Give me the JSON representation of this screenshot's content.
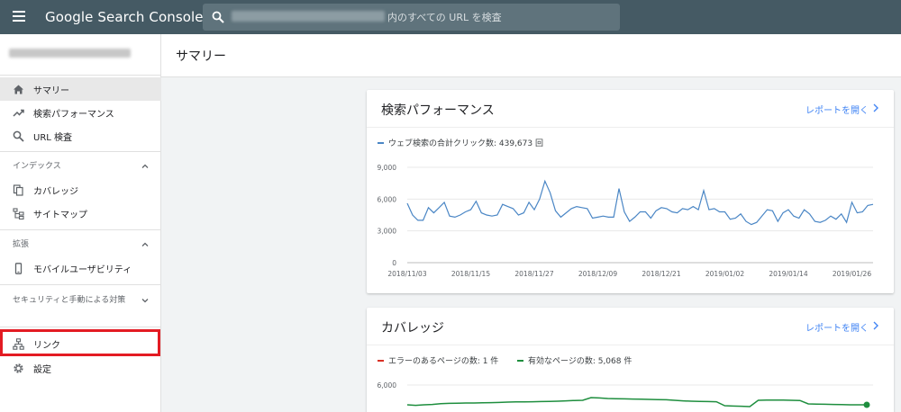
{
  "app": {
    "title": "Google Search Console"
  },
  "search": {
    "placeholder": "内のすべての URL を検査"
  },
  "sidebar": {
    "nav_top": [
      {
        "label": "サマリー",
        "icon": "home-icon",
        "active": true
      },
      {
        "label": "検索パフォーマンス",
        "icon": "trending-up-icon",
        "active": false
      },
      {
        "label": "URL 検査",
        "icon": "search-icon",
        "active": false
      }
    ],
    "sections": [
      {
        "label": "インデックス",
        "expanded": true,
        "items": [
          {
            "label": "カバレッジ",
            "icon": "file-copy-icon"
          },
          {
            "label": "サイトマップ",
            "icon": "sitemap-icon"
          }
        ]
      },
      {
        "label": "拡張",
        "expanded": true,
        "items": [
          {
            "label": "モバイルユーザビリティ",
            "icon": "smartphone-icon"
          }
        ]
      },
      {
        "label": "セキュリティと手動による対策",
        "expanded": false,
        "items": []
      }
    ],
    "nav_bottom": [
      {
        "label": "リンク",
        "icon": "links-icon"
      },
      {
        "label": "設定",
        "icon": "gear-icon"
      }
    ]
  },
  "page": {
    "title": "サマリー"
  },
  "cards": {
    "performance": {
      "title": "検索パフォーマンス",
      "link": "レポートを開く"
    },
    "coverage": {
      "title": "カバレッジ",
      "link": "レポートを開く"
    }
  },
  "colors": {
    "topbar": "#455a64",
    "accent": "#4285f4",
    "line_blue": "#4a86c5",
    "error_red": "#d93025",
    "valid_green": "#1e8e3e",
    "highlight": "#e31b23"
  },
  "chart_data": [
    {
      "type": "line",
      "legend": "ウェブ検索の合計クリック数: 439,673 回",
      "y_ticks": [
        "9,000",
        "6,000",
        "3,000",
        "0"
      ],
      "ylim": [
        0,
        9000
      ],
      "x_tick_labels": [
        "2018/11/03",
        "2018/11/15",
        "2018/11/27",
        "2018/12/09",
        "2018/12/21",
        "2019/01/02",
        "2019/01/14",
        "2019/01/26"
      ],
      "x_start": "2018/11/03",
      "series": [
        {
          "color": "#4a86c5",
          "values": [
            5600,
            4500,
            4000,
            4000,
            5200,
            4700,
            5200,
            5700,
            4400,
            4300,
            4500,
            4800,
            5000,
            5800,
            4700,
            4500,
            4400,
            4500,
            5500,
            5300,
            5100,
            4500,
            4700,
            5700,
            5000,
            6000,
            7700,
            6600,
            4900,
            4300,
            4700,
            5100,
            5300,
            5200,
            5100,
            4200,
            4300,
            4400,
            4300,
            4300,
            7000,
            4800,
            3900,
            4300,
            4800,
            4800,
            4200,
            4900,
            5200,
            5100,
            4800,
            4700,
            5100,
            5000,
            5300,
            5000,
            6800,
            5000,
            5100,
            4800,
            4800,
            4100,
            4200,
            4600,
            3900,
            3600,
            3800,
            4400,
            5000,
            4900,
            3900,
            4700,
            5000,
            4400,
            4200,
            5000,
            4600,
            3900,
            3800,
            4000,
            4400,
            4100,
            4600,
            3800,
            5700,
            4700,
            4800,
            5400,
            5500
          ]
        }
      ]
    },
    {
      "type": "line",
      "legend_series": [
        "エラーのあるページの数: 1 件",
        "有効なページの数: 5,068 件"
      ],
      "y_ticks": [
        "6,000"
      ],
      "series": [
        {
          "name": "有効なページの数: 5,068 件",
          "color": "#1e8e3e",
          "values": [
            4900,
            4870,
            4900,
            4920,
            4960,
            4980,
            4990,
            5000,
            5000,
            5010,
            5020,
            5030,
            5050,
            5060,
            5060,
            5070,
            5080,
            5090,
            5100,
            5120,
            5140,
            5150,
            5300,
            5280,
            5250,
            5240,
            5230,
            5220,
            5210,
            5200,
            5190,
            5180,
            5150,
            5120,
            5100,
            5090,
            5080,
            5070,
            4850,
            4830,
            4820,
            4800,
            5150,
            5160,
            5160,
            5160,
            5150,
            5140,
            4950,
            4940,
            4930,
            4920,
            4910,
            4900,
            4900,
            4900
          ]
        }
      ]
    }
  ]
}
